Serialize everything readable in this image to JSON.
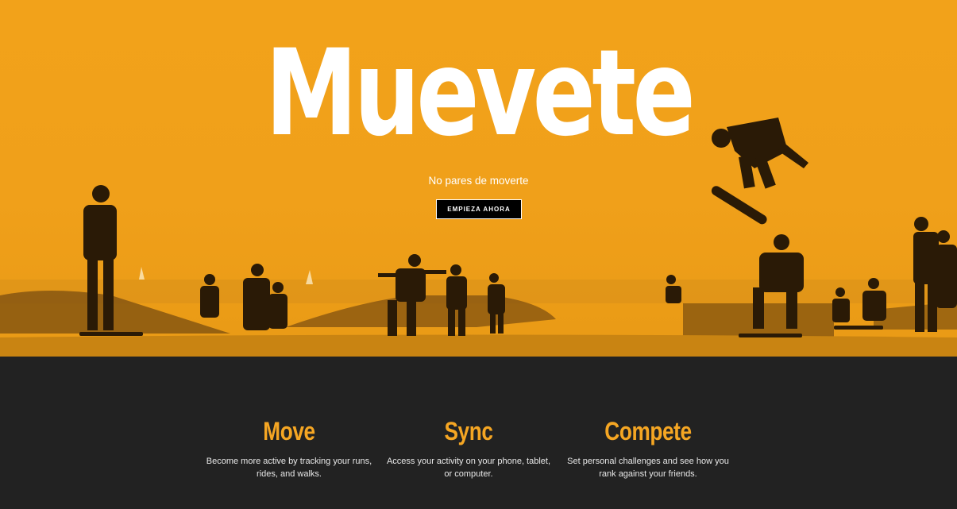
{
  "hero": {
    "title": "Muevete",
    "subtitle": "No pares de moverte",
    "cta_label": "EMPIEZA AHORA",
    "bg_color": "#f0a01a"
  },
  "features": [
    {
      "title": "Move",
      "text": "Become more active by tracking your runs, rides, and walks."
    },
    {
      "title": "Sync",
      "text": "Access your activity on your phone, tablet, or computer."
    },
    {
      "title": "Compete",
      "text": "Set personal challenges and see how you rank against your friends."
    }
  ],
  "accent_color": "#f5a623"
}
